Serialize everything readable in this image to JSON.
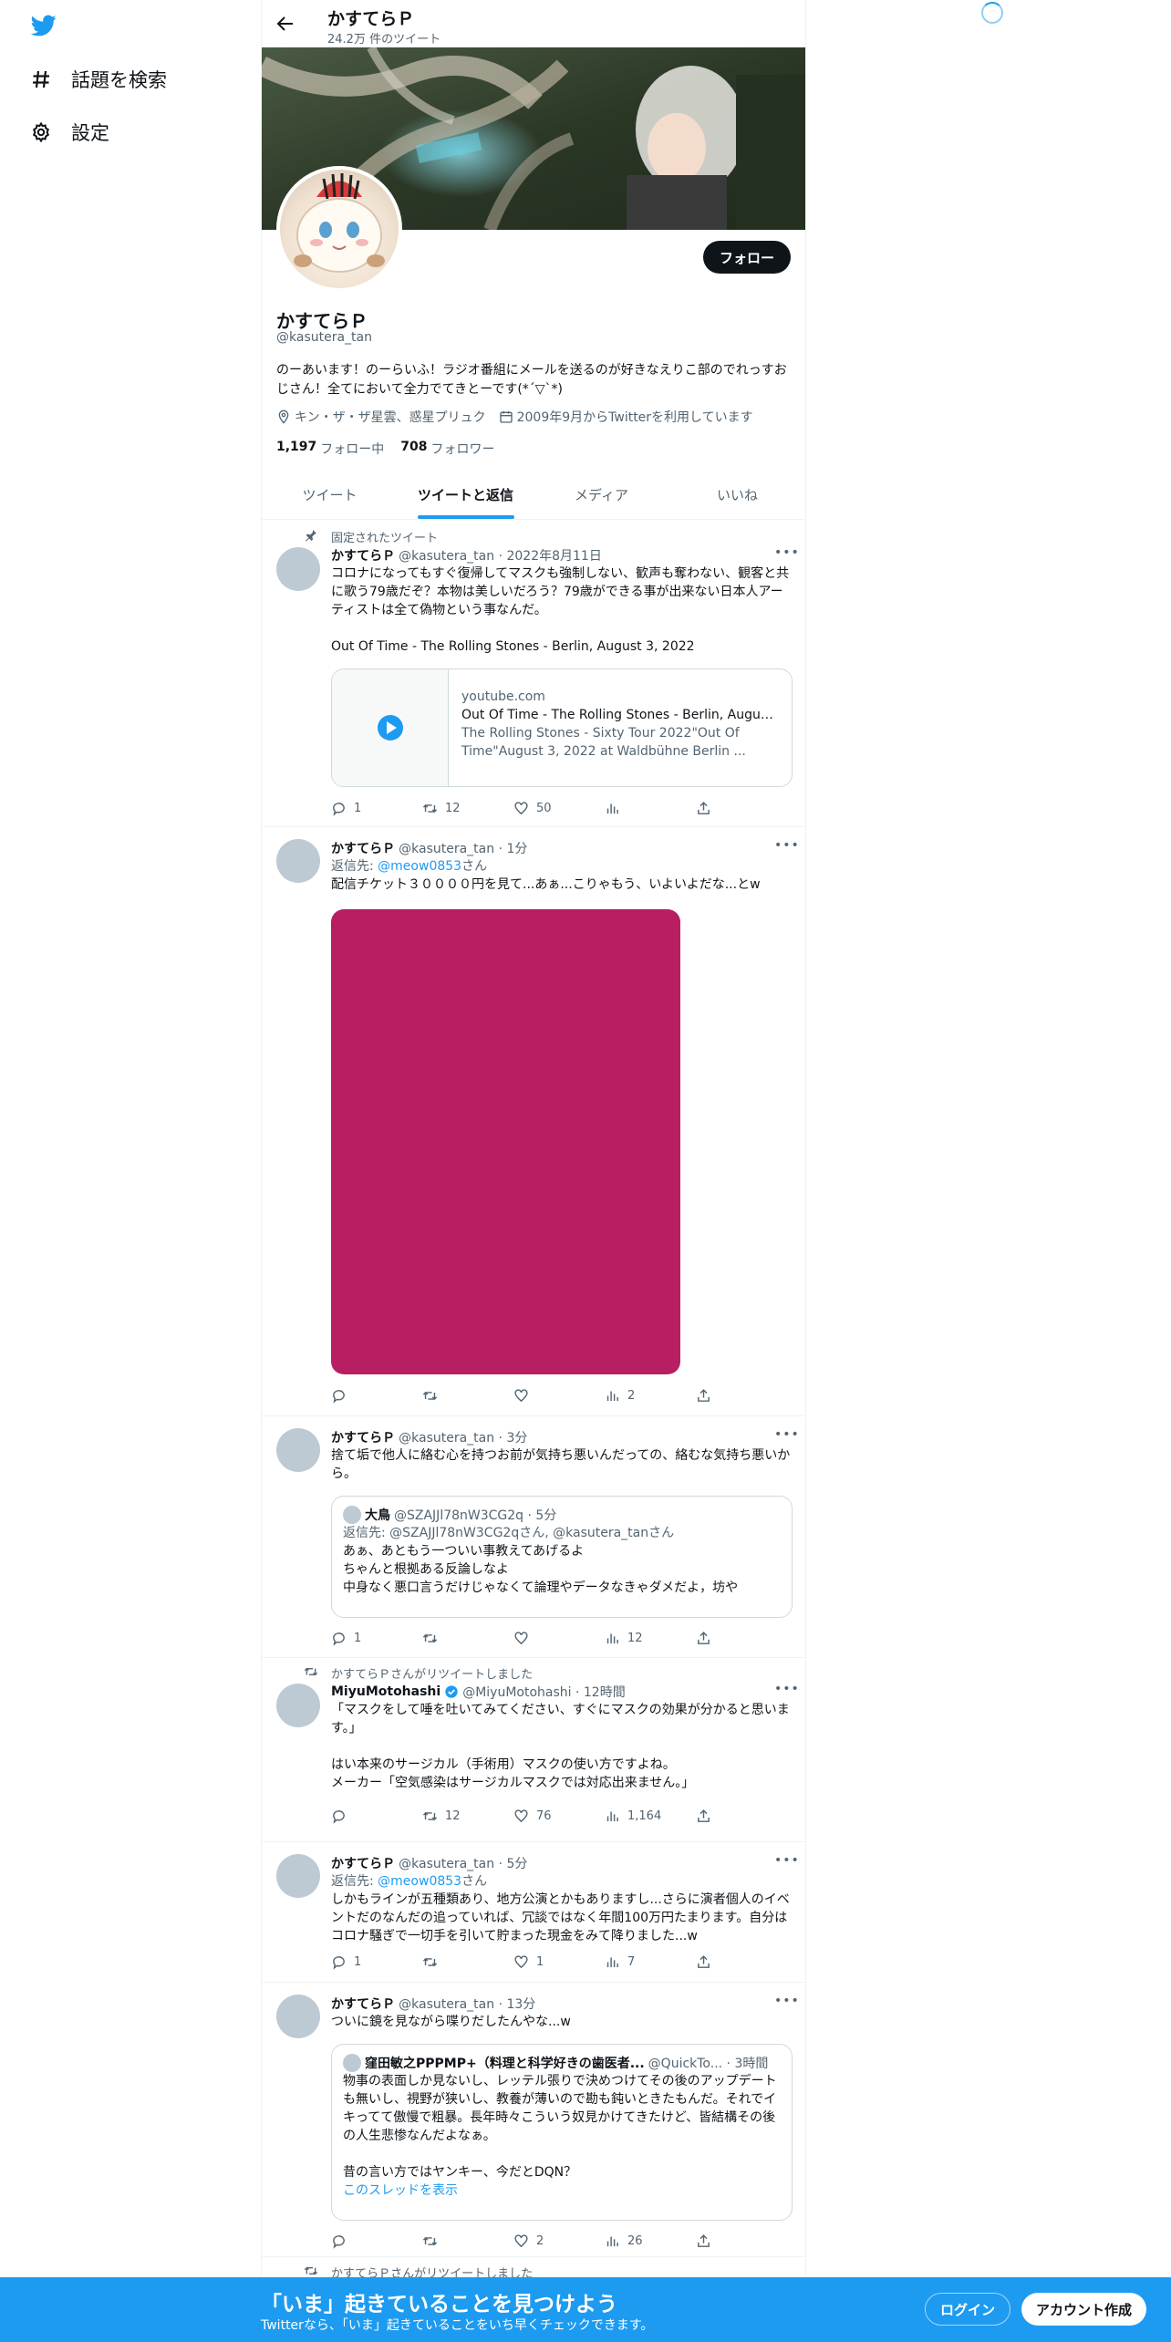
{
  "nav": {
    "logo_icon": "twitter-bird-icon",
    "explore_label": "話題を検索",
    "settings_label": "設定"
  },
  "header": {
    "name": "かすてらＰ",
    "tweet_count": "24.2万 件のツイート"
  },
  "profile": {
    "follow_label": "フォロー",
    "name": "かすてらＰ",
    "handle": "@kasutera_tan",
    "bio": "のーあいます！のーらいふ！ラジオ番組にメールを送るのが好きなえりこ部のでれっすおじさん！全てにおいて全力でてきとーです(*´▽`*)",
    "location": "キン・ザ・ザ星雲、惑星プリュク",
    "joined": "2009年9月からTwitterを利用しています",
    "following_count": "1,197",
    "following_label": "フォロー中",
    "followers_count": "708",
    "followers_label": "フォロワー"
  },
  "tabs": [
    {
      "label": "ツイート"
    },
    {
      "label": "ツイートと返信"
    },
    {
      "label": "メディア"
    },
    {
      "label": "いいね"
    }
  ],
  "tweets": [
    {
      "context": "固定されたツイート",
      "name": "かすてらＰ",
      "meta": "@kasutera_tan · 2022年8月11日",
      "text": "コロナになってもすぐ復帰してマスクも強制しない、歓声も奪わない、観客と共に歌う79歳だぞ？本物は美しいだろう？79歳ができる事が出来ない日本人アーティストは全て偽物という事なんだ。\n\nOut Of Time - The Rolling Stones - Berlin, August 3, 2022",
      "card": {
        "domain": "youtube.com",
        "title": "Out Of Time - The Rolling Stones - Berlin, August ...",
        "desc": "The Rolling Stones - Sixty Tour 2022\"Out Of Time\"August 3, 2022 at Waldbühne Berlin ..."
      },
      "replies": "1",
      "retweets": "12",
      "likes": "50"
    },
    {
      "name": "かすてらＰ",
      "meta": "@kasutera_tan · 1分",
      "reply_prefix": "返信先: ",
      "reply_to": "@meow0853",
      "reply_suffix": "さん",
      "text": "配信チケット３００００円を見て...あぁ...こりゃもう、いよいよだな...とw",
      "views": "2"
    },
    {
      "name": "かすてらＰ",
      "meta": "@kasutera_tan · 3分",
      "text": "捨て垢で他人に絡む心を持つお前が気持ち悪いんだっての、絡むな気持ち悪いから。",
      "quote": {
        "name": "大鳥",
        "meta": "@SZAJJl78nW3CG2q · 5分",
        "reply": "返信先: @SZAJJl78nW3CG2qさん, @kasutera_tanさん",
        "text": "あぁ、あともう一ついい事教えてあげるよ\nちゃんと根拠ある反論しなよ\n中身なく悪口言うだけじゃなくて論理やデータなきゃダメだよ，坊や"
      },
      "replies": "1",
      "views": "12"
    },
    {
      "context": "かすてらＰさんがリツイートしました",
      "name": "MiyuMotohashi",
      "meta": "@MiyuMotohashi · 12時間",
      "text": "「マスクをして唾を吐いてみてください、すぐにマスクの効果が分かると思います。」\n\nはい本来のサージカル（手術用）マスクの使い方ですよね。\nメーカー「空気感染はサージカルマスクでは対応出来ません。」",
      "retweets": "12",
      "likes": "76",
      "views": "1,164"
    },
    {
      "name": "かすてらＰ",
      "meta": "@kasutera_tan · 5分",
      "reply_prefix": "返信先: ",
      "reply_to": "@meow0853",
      "reply_suffix": "さん",
      "text": "しかもラインが五種類あり、地方公演とかもありますし...さらに演者個人のイベントだのなんだの追っていれば、冗談ではなく年間100万円たまります。自分はコロナ騒ぎで一切手を引いて貯まった現金をみて降りました...w",
      "replies": "1",
      "likes": "1",
      "views": "7"
    },
    {
      "name": "かすてらＰ",
      "meta": "@kasutera_tan · 13分",
      "text": "ついに鏡を見ながら喋りだしたんやな...w",
      "quote": {
        "name": "窪田敏之PPPMP+（料理と科学好きの歯医者...",
        "meta": "@QuickTo... · 3時間",
        "text": "物事の表面しか見ないし、レッテル張りで決めつけてその後のアップデートも無いし、視野が狭いし、教養が薄いので勘も鈍いときたもんだ。それでイキってて傲慢で粗暴。長年時々こういう奴見かけてきたけど、皆結構その後の人生悲惨なんだよなぁ。\n\n昔の言い方ではヤンキー、今だとDQN？",
        "link": "このスレッドを表示"
      },
      "likes": "2",
      "views": "26"
    },
    {
      "context": "かすてらＰさんがリツイートしました"
    }
  ],
  "bottom": {
    "title": "「いま」起きていることを見つけよう",
    "subtitle": "Twitterなら、「いま」起きていることをいち早くチェックできます。",
    "login_label": "ログイン",
    "signup_label": "アカウント作成"
  },
  "colors": {
    "accent": "#1d9bf0",
    "media": "#b81e62"
  }
}
